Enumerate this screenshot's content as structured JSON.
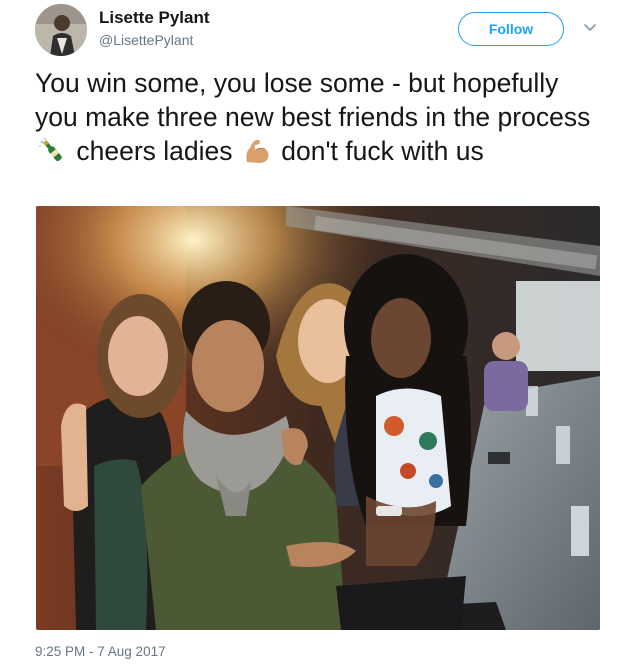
{
  "author": {
    "display_name": "Lisette Pylant",
    "handle": "@LisettePylant",
    "avatar_icon": "user-avatar"
  },
  "follow_button": {
    "label": "Follow",
    "color": "#1da1f2"
  },
  "menu_icon": "chevron-down-icon",
  "tweet": {
    "text_part_1": "You win some, you lose some - but hopefully you make three new best friends in the process",
    "emoji_1": "champagne-emoji",
    "text_part_2": "cheers ladies",
    "emoji_2": "flexed-biceps-emoji",
    "text_part_3": "don't fuck with us"
  },
  "photo": {
    "kind": "photo-of-four-women-at-bar"
  },
  "timestamp": "9:25 PM - 7 Aug 2017"
}
